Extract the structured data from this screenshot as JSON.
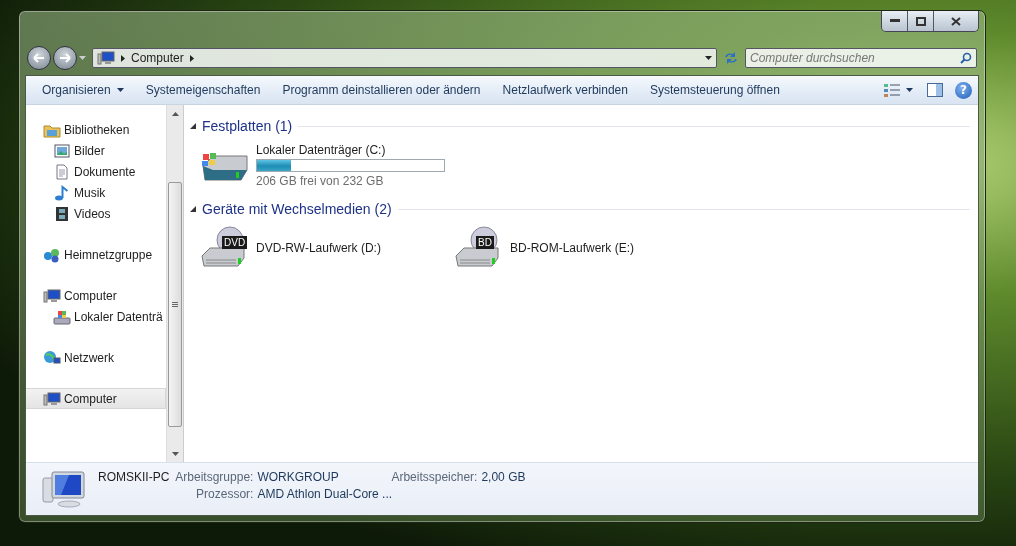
{
  "address_bar": {
    "breadcrumbs": [
      "Computer"
    ]
  },
  "search": {
    "placeholder": "Computer durchsuchen"
  },
  "command_bar": {
    "items": [
      {
        "label": "Organisieren",
        "dropdown": true
      },
      {
        "label": "Systemeigenschaften",
        "dropdown": false
      },
      {
        "label": "Programm deinstallieren oder ändern",
        "dropdown": false
      },
      {
        "label": "Netzlaufwerk verbinden",
        "dropdown": false
      },
      {
        "label": "Systemsteuerung öffnen",
        "dropdown": false
      }
    ],
    "help": "?"
  },
  "sidebar": {
    "sections": [
      {
        "label": "Bibliotheken",
        "kind": "library",
        "selected": false,
        "children": [
          {
            "label": "Bilder",
            "kind": "pictures",
            "selected": false
          },
          {
            "label": "Dokumente",
            "kind": "documents",
            "selected": false
          },
          {
            "label": "Musik",
            "kind": "music",
            "selected": false
          },
          {
            "label": "Videos",
            "kind": "videos",
            "selected": false
          }
        ]
      },
      {
        "label": "Heimnetzgruppe",
        "kind": "homegroup",
        "selected": false
      },
      {
        "label": "Computer",
        "kind": "computer",
        "selected": false,
        "children": [
          {
            "label": "Lokaler Datenträ",
            "kind": "drive",
            "selected": false
          }
        ]
      },
      {
        "label": "Netzwerk",
        "kind": "network",
        "selected": false
      },
      {
        "label": "Computer",
        "kind": "computer",
        "selected": true
      }
    ]
  },
  "groups": [
    {
      "title": "Festplatten (1)",
      "drives": [
        {
          "kind": "hdd",
          "name": "Lokaler Datenträger (C:)",
          "level": 0.18,
          "free": "206 GB frei von 232 GB"
        }
      ]
    },
    {
      "title": "Geräte mit Wechselmedien (2)",
      "drives": [
        {
          "kind": "optical",
          "badge": "DVD",
          "name": "DVD-RW-Laufwerk (D:)"
        },
        {
          "kind": "optical",
          "badge": "BD",
          "name": "BD-ROM-Laufwerk (E:)"
        }
      ]
    }
  ],
  "details": {
    "name": "ROMSKII-PC",
    "fields": [
      {
        "label": "Arbeitsgruppe:",
        "value": "WORKGROUP"
      },
      {
        "label": "Arbeitsspeicher:",
        "value": "2,00 GB"
      },
      {
        "label": "Prozessor:",
        "value": "AMD Athlon Dual-Core ..."
      }
    ]
  }
}
